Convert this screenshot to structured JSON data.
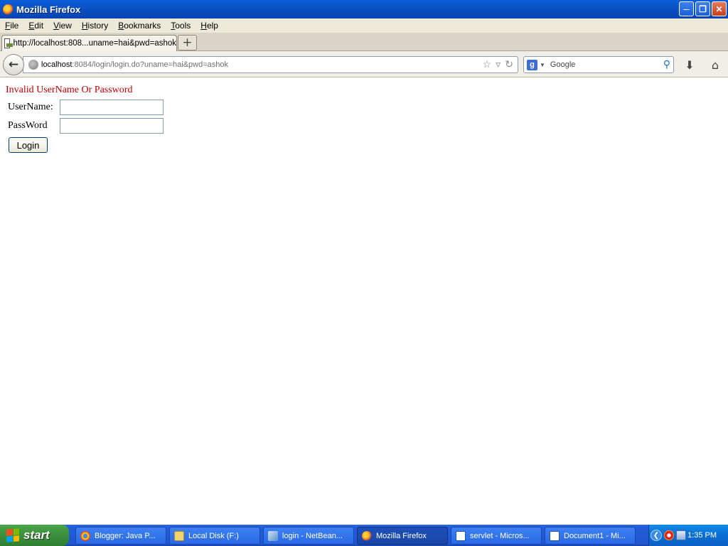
{
  "window": {
    "title": "Mozilla Firefox"
  },
  "menu": [
    "File",
    "Edit",
    "View",
    "History",
    "Bookmarks",
    "Tools",
    "Help"
  ],
  "menu_access_keys": [
    "F",
    "E",
    "V",
    "H",
    "B",
    "T",
    "H"
  ],
  "tab": {
    "title": "http://localhost:808...uname=hai&pwd=ashok",
    "new_tab_symbol": "+"
  },
  "navigation": {
    "url_host": "localhost",
    "url_rest": ":8084/login/login.do?uname=hai&pwd=ashok",
    "search_engine": "Google",
    "search_placeholder": "Google"
  },
  "page": {
    "error_message": "Invalid UserName Or Password",
    "username_label": "UserName:",
    "password_label": "PassWord",
    "username_value": "",
    "password_value": "",
    "login_button": "Login",
    "error_color": "#c00000"
  },
  "taskbar": {
    "start_label": "start",
    "items": [
      {
        "label": "Blogger: Java P...",
        "icon": "chrome-icon"
      },
      {
        "label": "Local Disk (F:)",
        "icon": "folder-icon"
      },
      {
        "label": "login - NetBean...",
        "icon": "netbeans-icon"
      },
      {
        "label": "Mozilla Firefox",
        "icon": "firefox-icon",
        "active": true
      },
      {
        "label": "servlet - Micros...",
        "icon": "word-icon"
      },
      {
        "label": "Document1 - Mi...",
        "icon": "word-icon"
      }
    ],
    "clock": "1:35 PM"
  }
}
